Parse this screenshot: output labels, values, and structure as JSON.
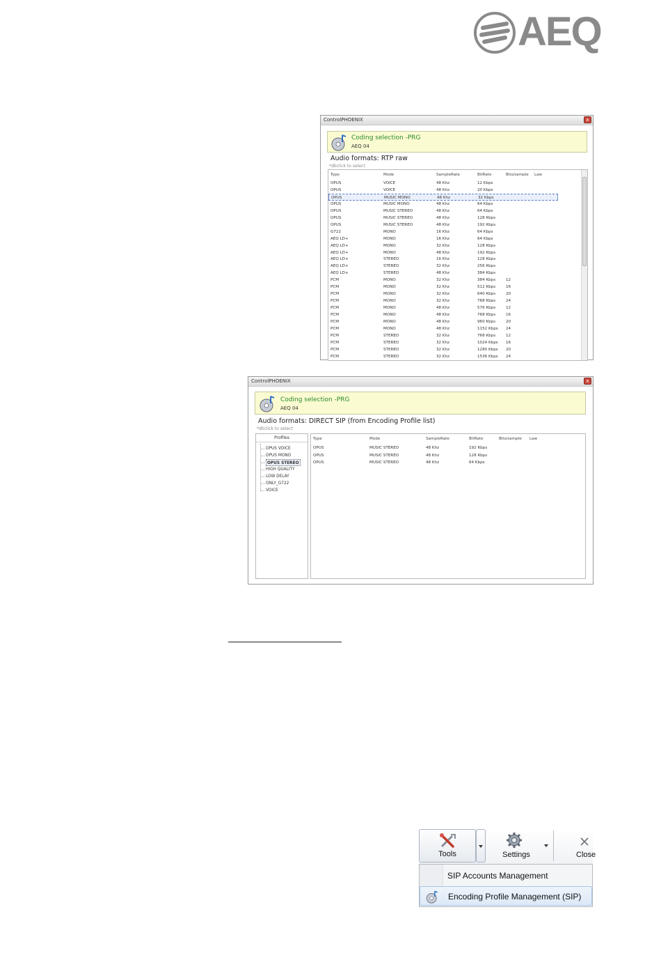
{
  "logo": {
    "text": "AEQ"
  },
  "window1": {
    "title": "ControlPHOENIX",
    "close_glyph": "x",
    "header_title": "Coding selection -PRG",
    "header_sub": "AEQ 04",
    "section_title": "Audio formats: RTP raw",
    "hint": "*dbclick to select",
    "columns": [
      "Type",
      "Mode",
      "SampleRate",
      "BitRate",
      "Bits/sample",
      "Law"
    ],
    "selected_row": 2,
    "rows": [
      [
        "OPUS",
        "VOICE",
        "48 Khz",
        "12 Kbps",
        "",
        ""
      ],
      [
        "OPUS",
        "VOICE",
        "48 Khz",
        "20 Kbps",
        "",
        ""
      ],
      [
        "OPUS",
        "MUSIC MONO",
        "48 Khz",
        "32 Kbps",
        "",
        ""
      ],
      [
        "OPUS",
        "MUSIC MONO",
        "48 Khz",
        "64 Kbps",
        "",
        ""
      ],
      [
        "OPUS",
        "MUSIC STEREO",
        "48 Khz",
        "64 Kbps",
        "",
        ""
      ],
      [
        "OPUS",
        "MUSIC STEREO",
        "48 Khz",
        "128 Kbps",
        "",
        ""
      ],
      [
        "OPUS",
        "MUSIC STEREO",
        "48 Khz",
        "192 Kbps",
        "",
        ""
      ],
      [
        "G722",
        "MONO",
        "16 Khz",
        "64 Kbps",
        "",
        ""
      ],
      [
        "AEQ LD+",
        "MONO",
        "16 Khz",
        "64 Kbps",
        "",
        ""
      ],
      [
        "AEQ LD+",
        "MONO",
        "32 Khz",
        "128 Kbps",
        "",
        ""
      ],
      [
        "AEQ LD+",
        "MONO",
        "48 Khz",
        "192 Kbps",
        "",
        ""
      ],
      [
        "AEQ LD+",
        "STEREO",
        "16 Khz",
        "128 Kbps",
        "",
        ""
      ],
      [
        "AEQ LD+",
        "STEREO",
        "32 Khz",
        "256 Kbps",
        "",
        ""
      ],
      [
        "AEQ LD+",
        "STEREO",
        "48 Khz",
        "384 Kbps",
        "",
        ""
      ],
      [
        "PCM",
        "MONO",
        "32 Khz",
        "384 Kbps",
        "12",
        ""
      ],
      [
        "PCM",
        "MONO",
        "32 Khz",
        "512 Kbps",
        "16",
        ""
      ],
      [
        "PCM",
        "MONO",
        "32 Khz",
        "640 Kbps",
        "20",
        ""
      ],
      [
        "PCM",
        "MONO",
        "32 Khz",
        "768 Kbps",
        "24",
        ""
      ],
      [
        "PCM",
        "MONO",
        "48 Khz",
        "576 Kbps",
        "12",
        ""
      ],
      [
        "PCM",
        "MONO",
        "48 Khz",
        "768 Kbps",
        "16",
        ""
      ],
      [
        "PCM",
        "MONO",
        "48 Khz",
        "960 Kbps",
        "20",
        ""
      ],
      [
        "PCM",
        "MONO",
        "48 Khz",
        "1152 Kbps",
        "24",
        ""
      ],
      [
        "PCM",
        "STEREO",
        "32 Khz",
        "768 Kbps",
        "12",
        ""
      ],
      [
        "PCM",
        "STEREO",
        "32 Khz",
        "1024 Kbps",
        "16",
        ""
      ],
      [
        "PCM",
        "STEREO",
        "32 Khz",
        "1280 Kbps",
        "20",
        ""
      ],
      [
        "PCM",
        "STEREO",
        "32 Khz",
        "1536 Kbps",
        "24",
        ""
      ]
    ]
  },
  "window2": {
    "title": "ControlPHOENIX",
    "close_glyph": "x",
    "header_title": "Coding selection -PRG",
    "header_sub": "AEQ 04",
    "section_title": "Audio formats: DIRECT SIP (from Encoding Profile list)",
    "hint": "*dbclick to select",
    "profiles_header": "Profiles",
    "profiles": [
      "OPUS VOICE",
      "OPUS MONO",
      "OPUS STEREO",
      "HIGH QUALITY",
      "LOW DELAY",
      "ONLY_G722",
      "VOICE"
    ],
    "selected_profile": 2,
    "columns": [
      "Type",
      "Mode",
      "SampleRate",
      "BitRate",
      "Bits/sample",
      "Law"
    ],
    "rows": [
      [
        "OPUS",
        "MUSIC STEREO",
        "48 Khz",
        "192 Kbps",
        "",
        ""
      ],
      [
        "OPUS",
        "MUSIC STEREO",
        "48 Khz",
        "128 Kbps",
        "",
        ""
      ],
      [
        "OPUS",
        "MUSIC STEREO",
        "48 Khz",
        "64 Kbps",
        "",
        ""
      ]
    ]
  },
  "toolbar": {
    "tools_label": "Tools",
    "settings_label": "Settings",
    "close_label": "Close",
    "icons": {
      "tools": "tools-icon",
      "settings": "gear-icon",
      "close": "close-icon"
    }
  },
  "menu": {
    "items": [
      {
        "label": "SIP Accounts Management",
        "icon": ""
      },
      {
        "label": "Encoding Profile Management (SIP)",
        "icon": "codec-disc-icon"
      }
    ],
    "highlighted": 1
  }
}
